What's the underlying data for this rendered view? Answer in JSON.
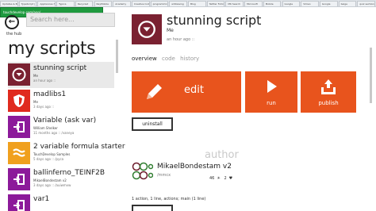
{
  "browser": {
    "tabs": [
      "Updates & Boise - W",
      "TypeScript | Type 1st",
      "Appliances Home",
      "Typica",
      "Recycled",
      "RayMobile",
      "Academy",
      "Creative Code Home",
      "programming",
      "whitewing",
      "Blog",
      "Twitter Follow",
      "MK Search",
      "Microsoft",
      "Mobile",
      "Google",
      "Vimeo",
      "Google",
      "beige",
      "quiz sections"
    ],
    "url": "touchdevelop.com/app/"
  },
  "nav": {
    "back_label": "the hub",
    "search_placeholder": "Search here..."
  },
  "left": {
    "title": "my scripts",
    "items": [
      {
        "name": "stunning script",
        "meta1": "Me",
        "meta2": "an hour ago ::",
        "color": "#7a2131",
        "icon": "chevron-circle-icon"
      },
      {
        "name": "madlibs1",
        "meta1": "Me",
        "meta2": "3 days ago ::",
        "color": "#e02a1e",
        "icon": "shield-icon"
      },
      {
        "name": "Variable (ask var)",
        "meta1": "William Shelker",
        "meta2": "11 months ago :: /vaneya",
        "color": "#8c1a9a",
        "icon": "enter-icon"
      },
      {
        "name": "2 variable formula starter",
        "meta1": "TouchDevelop Samples",
        "meta2": "5 days ago :: /pyca",
        "color": "#f0a01e",
        "icon": "waves-icon"
      },
      {
        "name": "ballinferno_TEINF2B",
        "meta1": "MikaelBondestam v2",
        "meta2": "3 days ago :: /auiwmvw",
        "color": "#8c1a9a",
        "icon": "enter-icon"
      },
      {
        "name": "var1",
        "meta1": "",
        "meta2": "",
        "color": "#8c1a9a",
        "icon": "enter-icon"
      }
    ]
  },
  "script": {
    "title": "stunning script",
    "author": "Me",
    "time": "an hour ago ::",
    "color": "#7a2131"
  },
  "tabs": {
    "overview": "overview",
    "code": "code",
    "history": "history"
  },
  "actions": {
    "edit": "edit",
    "run": "run",
    "publish": "publish",
    "uninstall": "uninstall",
    "tile_color": "#e8541d"
  },
  "author_section": {
    "heading": "author",
    "name": "MikaelBondestam v2",
    "handle": "/mmcx",
    "score": "46",
    "hearts": "2",
    "summary": "1 action, 1 line, actions; main (1 line)"
  }
}
